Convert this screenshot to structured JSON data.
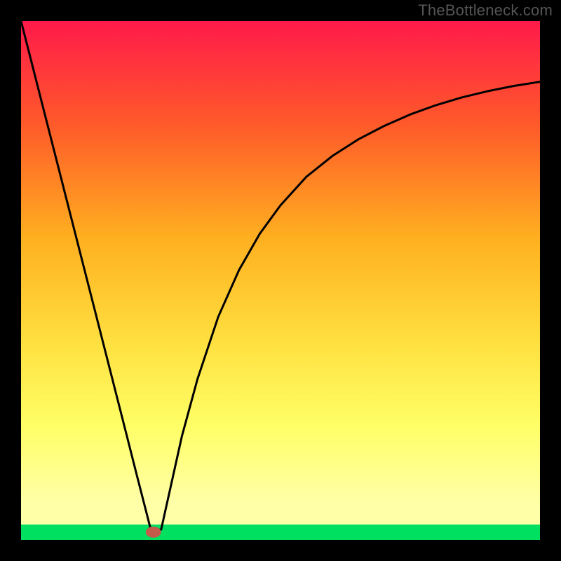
{
  "brand": "TheBottleneck.com",
  "colors": {
    "frame": "#000000",
    "gradient_top": "#ff1a4a",
    "gradient_mid1": "#ff5a2a",
    "gradient_mid2": "#ffb020",
    "gradient_mid3": "#ffe040",
    "gradient_mid4": "#ffff66",
    "gradient_mid5": "#ffffa8",
    "gradient_green": "#00e060",
    "curve": "#000000",
    "marker_fill": "#c25b4a",
    "marker_stroke": "#c25b4a"
  },
  "chart_data": {
    "type": "line",
    "title": "",
    "xlabel": "",
    "ylabel": "",
    "xlim": [
      0,
      100
    ],
    "ylim": [
      0,
      100
    ],
    "series": [
      {
        "name": "bottleneck-curve",
        "x": [
          0,
          5,
          10,
          15,
          20,
          22,
          24,
          25,
          27,
          29,
          31,
          34,
          38,
          42,
          46,
          50,
          55,
          60,
          65,
          70,
          75,
          80,
          85,
          90,
          95,
          100
        ],
        "values": [
          100,
          80.4,
          60.8,
          41.2,
          21.6,
          13.7,
          5.9,
          2.0,
          2.0,
          11.0,
          20.0,
          31.0,
          43.0,
          52.0,
          59.0,
          64.5,
          70.0,
          74.0,
          77.2,
          79.8,
          82.0,
          83.8,
          85.3,
          86.5,
          87.5,
          88.3
        ]
      }
    ],
    "marker": {
      "x": 25.5,
      "y": 1.5,
      "rx": 1.4,
      "ry": 1.0
    },
    "gradient_bands": [
      {
        "y0": 100,
        "y1": 4,
        "type": "smooth",
        "colors": [
          "#ff1a4a",
          "#ff5a2a",
          "#ffb020",
          "#ffe040",
          "#ffff66",
          "#ffffa8"
        ]
      },
      {
        "y0": 4,
        "y1": 2,
        "type": "solid",
        "color": "#ffffa8"
      },
      {
        "y0": 2,
        "y1": 0,
        "type": "solid",
        "color": "#00e060"
      }
    ]
  }
}
